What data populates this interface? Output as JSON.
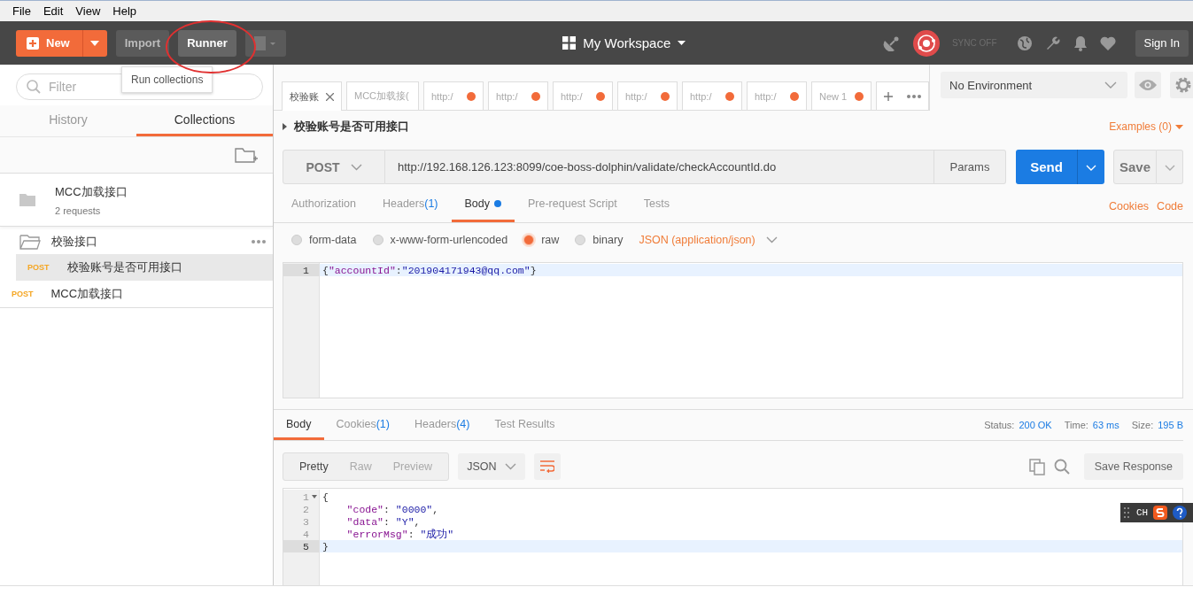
{
  "menu_bar": [
    "File",
    "Edit",
    "View",
    "Help"
  ],
  "header": {
    "new_button": "New",
    "import_button": "Import",
    "runner_button": "Runner",
    "tooltip": "Run collections",
    "workspace": "My Workspace",
    "sync_status": "SYNC OFF",
    "sign_in": "Sign In"
  },
  "sidebar": {
    "filter_placeholder": "Filter",
    "tabs": [
      {
        "label": "History",
        "selected": false
      },
      {
        "label": "Collections",
        "selected": true
      }
    ],
    "items": [
      {
        "kind": "collection",
        "name": "MCC加载接口",
        "subtitle": "2 requests"
      },
      {
        "kind": "folder",
        "name": "校验接口",
        "children": [
          {
            "method": "POST",
            "name": "校验账号是否可用接口",
            "selected": true
          }
        ]
      },
      {
        "kind": "request",
        "method": "POST",
        "name": "MCC加载接口",
        "selected": false
      }
    ]
  },
  "request_tabs": [
    {
      "label": "校验账",
      "selected": true,
      "unsaved": false
    },
    {
      "label": "MCC加载接(",
      "selected": false,
      "unsaved": false
    },
    {
      "label": "http:/",
      "selected": false,
      "unsaved": true
    },
    {
      "label": "http:/",
      "selected": false,
      "unsaved": true
    },
    {
      "label": "http:/",
      "selected": false,
      "unsaved": true
    },
    {
      "label": "http:/",
      "selected": false,
      "unsaved": true
    },
    {
      "label": "http:/",
      "selected": false,
      "unsaved": true
    },
    {
      "label": "http:/",
      "selected": false,
      "unsaved": true
    },
    {
      "label": "New 1",
      "selected": false,
      "unsaved": true
    }
  ],
  "environment": "No Environment",
  "request": {
    "name": "校验账号是否可用接口",
    "examples": "Examples (0)",
    "method": "POST",
    "url": "http://192.168.126.123:8099/coe-boss-dolphin/validate/checkAccountId.do",
    "params": "Params",
    "send": "Send",
    "save": "Save",
    "tabs": [
      {
        "label": "Authorization",
        "selected": false,
        "indicator": false
      },
      {
        "label": "Headers",
        "count": "(1)",
        "selected": false,
        "indicator": false
      },
      {
        "label": "Body",
        "selected": true,
        "indicator": true
      },
      {
        "label": "Pre-request Script",
        "selected": false,
        "indicator": false
      },
      {
        "label": "Tests",
        "selected": false,
        "indicator": false
      }
    ],
    "links": [
      "Cookies",
      "Code"
    ],
    "body_modes": [
      {
        "label": "form-data",
        "selected": false
      },
      {
        "label": "x-www-form-urlencoded",
        "selected": false
      },
      {
        "label": "raw",
        "selected": true
      },
      {
        "label": "binary",
        "selected": false
      }
    ],
    "content_type": "JSON (application/json)",
    "body_lines": [
      {
        "number": "1",
        "text": "{\"accountId\":\"201904171943@qq.com\"}",
        "current": true
      }
    ]
  },
  "response": {
    "tabs": [
      {
        "label": "Body",
        "selected": true
      },
      {
        "label": "Cookies",
        "count": "(1)",
        "selected": false
      },
      {
        "label": "Headers",
        "count": "(4)",
        "selected": false
      },
      {
        "label": "Test Results",
        "selected": false
      }
    ],
    "stats": [
      {
        "label": "Status:",
        "value": "200 OK"
      },
      {
        "label": "Time:",
        "value": "63 ms"
      },
      {
        "label": "Size:",
        "value": "195 B"
      }
    ],
    "view_modes": [
      {
        "label": "Pretty",
        "selected": true
      },
      {
        "label": "Raw",
        "selected": false
      },
      {
        "label": "Preview",
        "selected": false
      }
    ],
    "format": "JSON",
    "save_response": "Save Response",
    "lines": [
      {
        "number": "1",
        "text": "{",
        "current": false,
        "foldable": true
      },
      {
        "number": "2",
        "text": "    \"code\": \"0000\",",
        "current": false,
        "foldable": false
      },
      {
        "number": "3",
        "text": "    \"data\": \"Y\",",
        "current": false,
        "foldable": false
      },
      {
        "number": "4",
        "text": "    \"errorMsg\": \"成功\"",
        "current": false,
        "foldable": false
      },
      {
        "number": "5",
        "text": "}",
        "current": true,
        "foldable": false
      }
    ]
  },
  "ime_toolbar": {
    "label": "CH"
  }
}
